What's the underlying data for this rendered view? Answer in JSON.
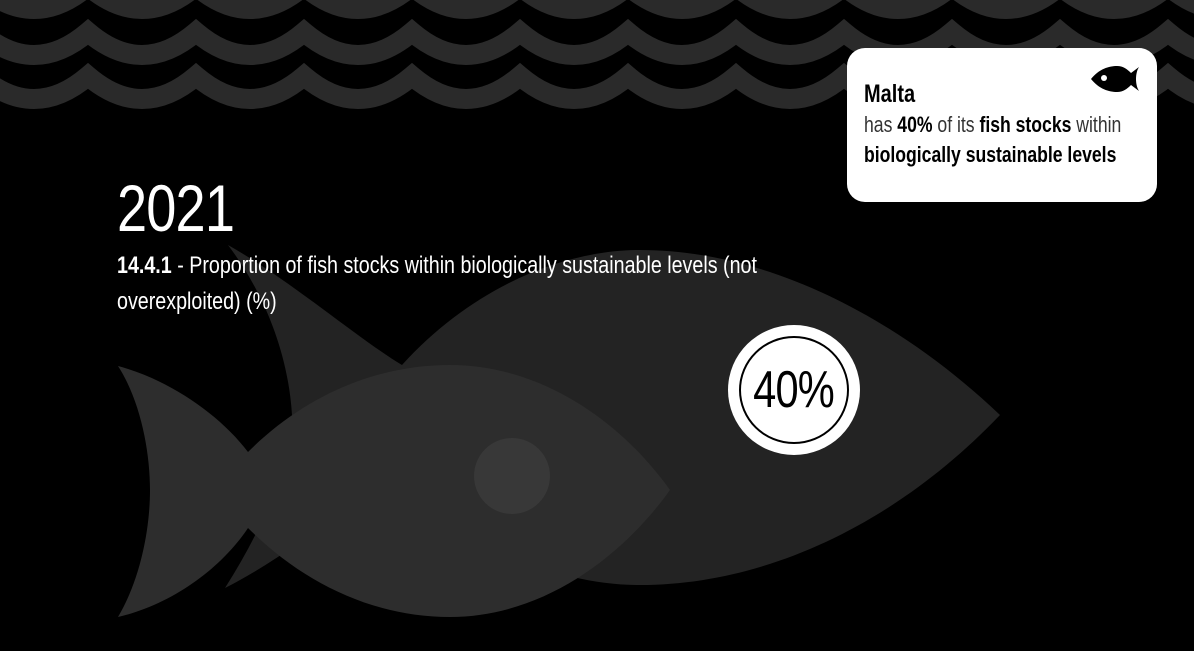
{
  "header": {
    "year": "2021",
    "indicator_code": "14.4.1",
    "indicator_separator": " - ",
    "indicator_title": "Proportion of fish stocks within biologically sustainable levels (not overexploited) (%)"
  },
  "badge": {
    "value_text": "40%",
    "value": 40
  },
  "card": {
    "country": "Malta",
    "text_has": "has ",
    "value_text": "40%",
    "text_of_its": " of its ",
    "fish_stocks": "fish stocks",
    "text_within": " within",
    "sustainable": "biologically sustainable levels",
    "icon": "fish-icon"
  },
  "colors": {
    "background": "#000000",
    "wave": "#2a2a2a",
    "fish_large": "#232323",
    "fish_small": "#2d2d2d",
    "fish_eye": "#383838",
    "card": "#ffffff"
  }
}
